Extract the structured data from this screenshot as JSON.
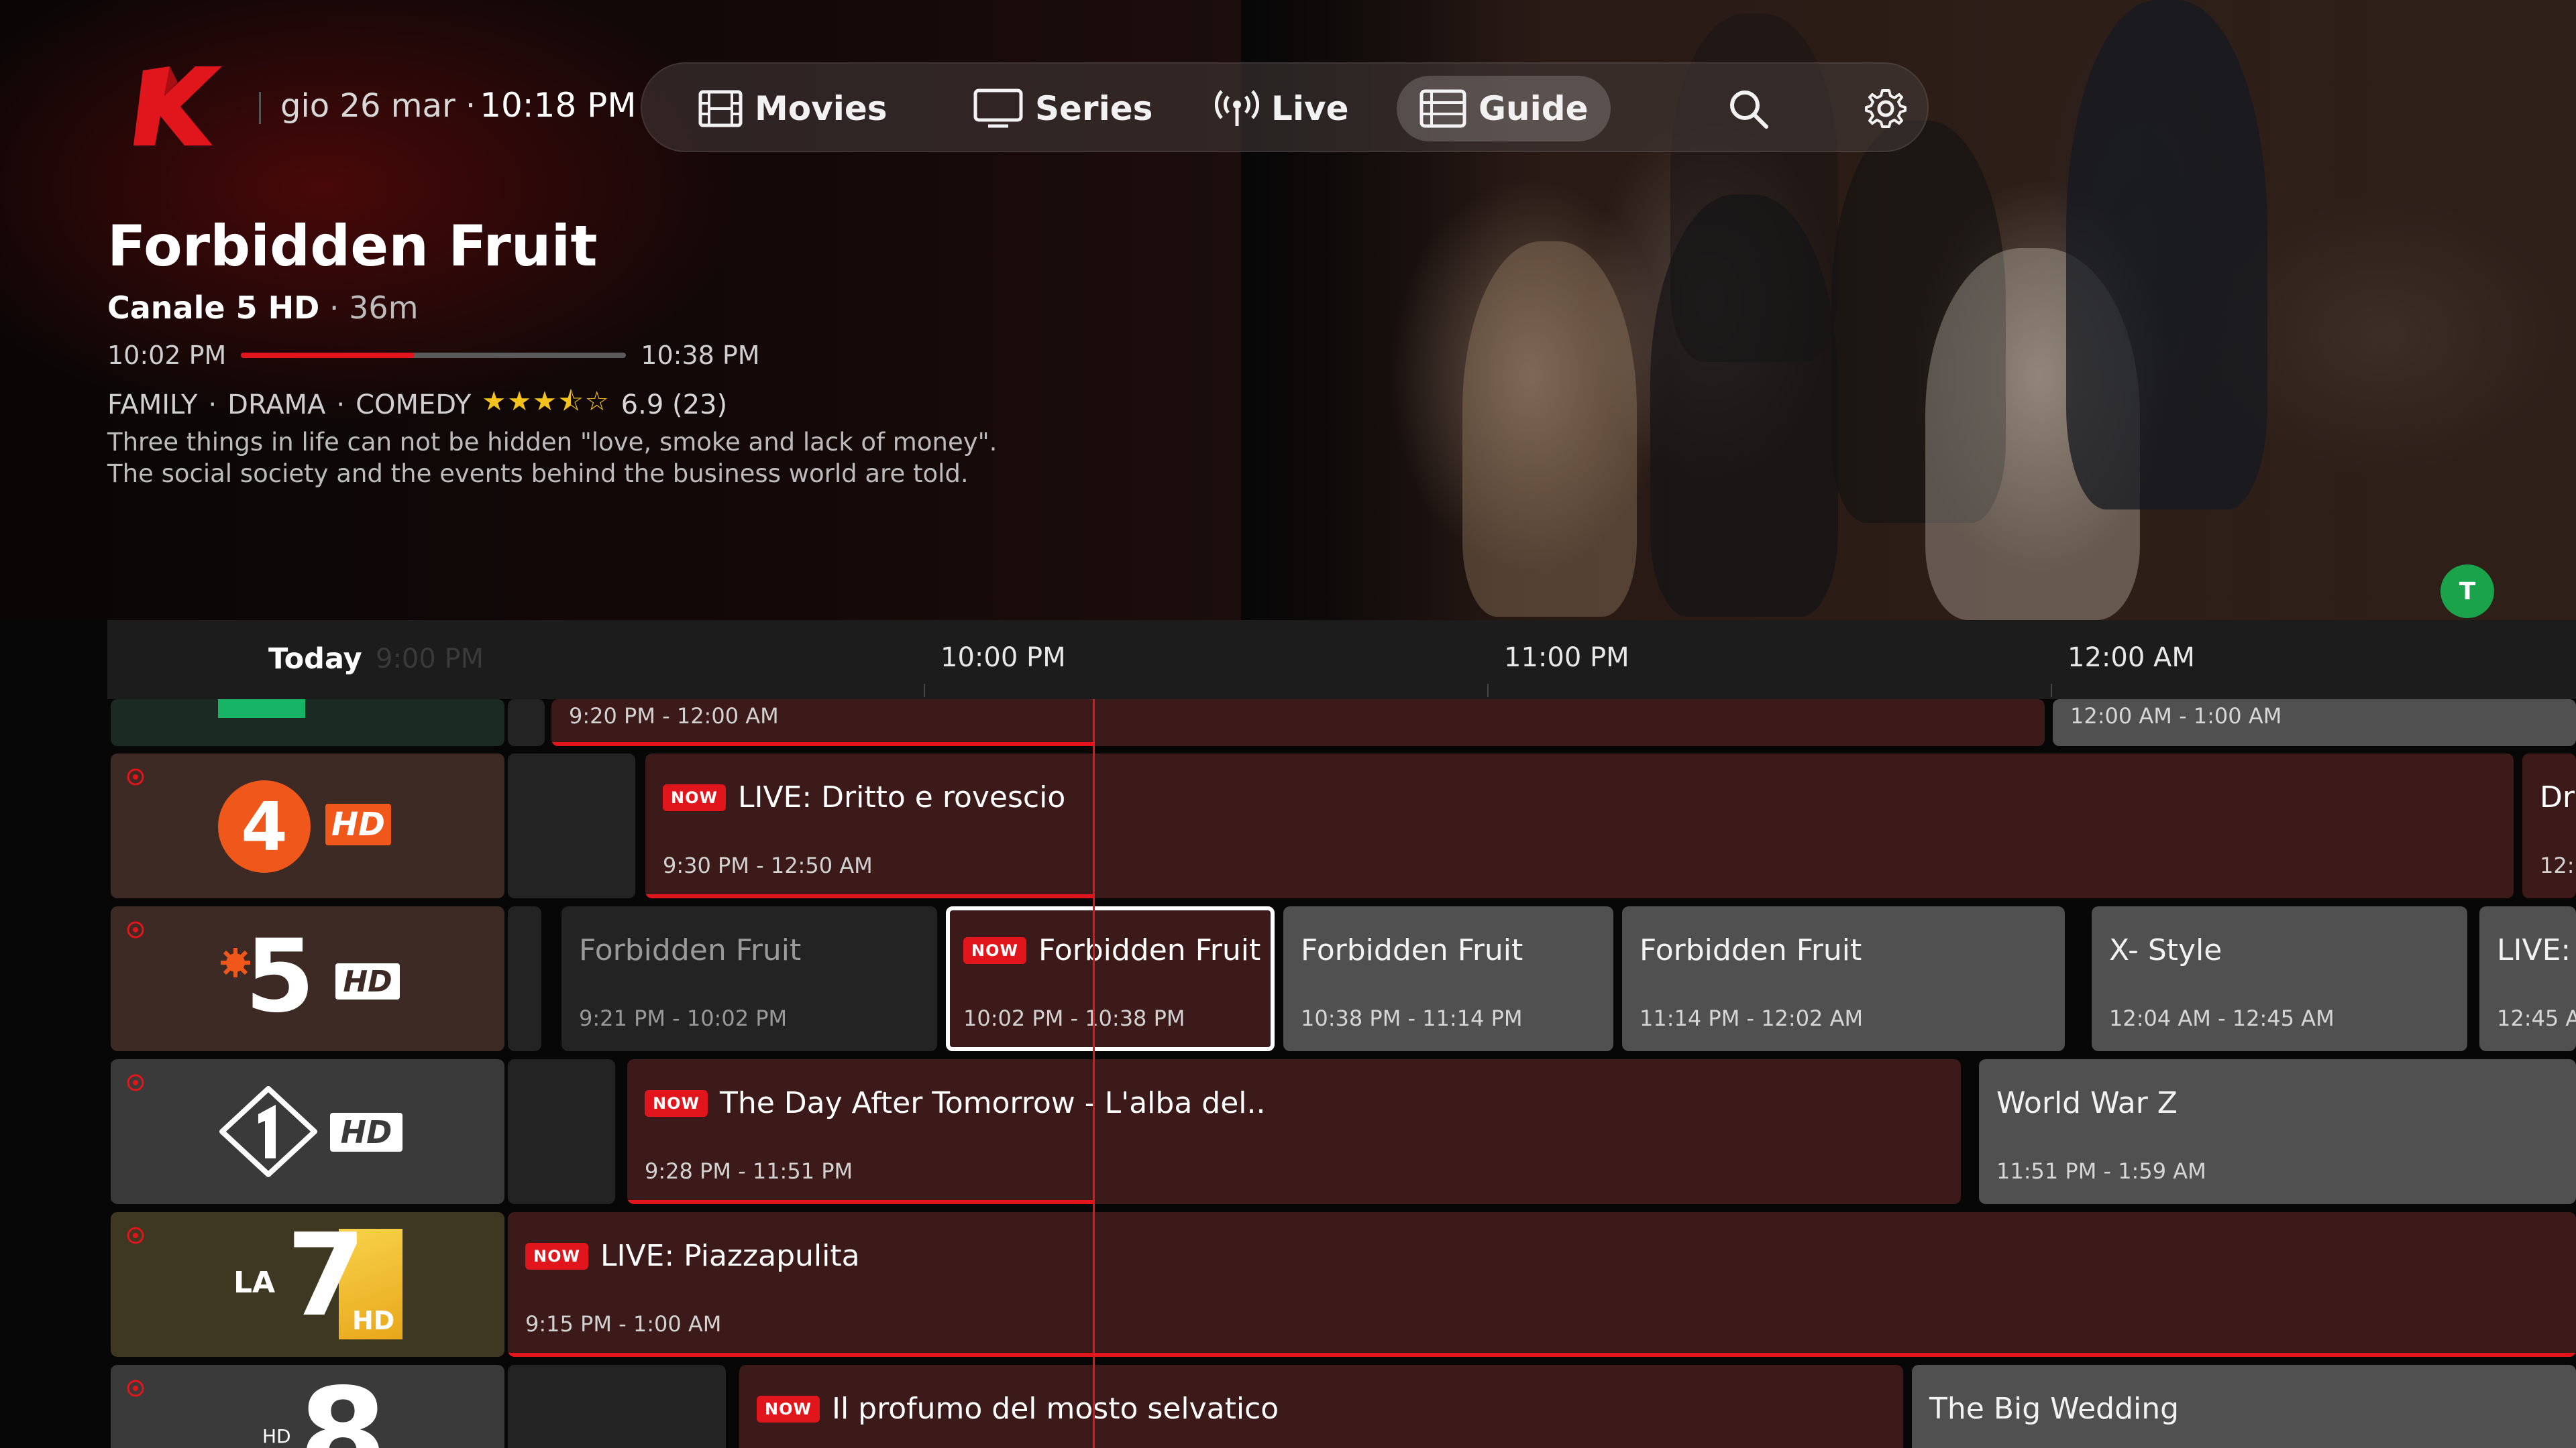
{
  "header": {
    "date": "gio 26 mar ·",
    "time": "10:18 PM"
  },
  "nav": {
    "movies": "Movies",
    "series": "Series",
    "live": "Live",
    "guide": "Guide",
    "active": "Guide"
  },
  "colors": {
    "accent": "#e0161c",
    "avatar": "#1aa34a"
  },
  "featured": {
    "title": "Forbidden Fruit",
    "channel": "Canale 5 HD",
    "duration": "36m",
    "start": "10:02 PM",
    "end": "10:38 PM",
    "progress_percent": 45,
    "genres": [
      "FAMILY",
      "DRAMA",
      "COMEDY"
    ],
    "stars_text": "★★★⯪☆",
    "rating_value": 3.5,
    "rating": "6.9 (23)",
    "description": "Three things in life can not be hidden \"love, smoke and lack of money\". The social society and the events behind the business world are told."
  },
  "avatar_letter": "T",
  "guide": {
    "today": "Today",
    "faded_time": "9:00 PM",
    "times": [
      "10:00 PM",
      "11:00 PM",
      "12:00 AM"
    ],
    "now_label": "NOW",
    "rows": [
      {
        "channel": "partial-green-channel",
        "programs": [
          {
            "time": "9:20 PM - 12:00 AM"
          },
          {
            "time": "12:00 AM - 1:00 AM"
          }
        ]
      },
      {
        "channel": "Rete 4 HD",
        "logo_text": "4",
        "hd": "HD",
        "programs": [
          {
            "title": "LIVE: Dritto e rovescio",
            "time": "9:30 PM - 12:50 AM"
          },
          {
            "title": "Dr",
            "time": "12:"
          }
        ]
      },
      {
        "channel": "Canale 5 HD",
        "logo_text": "5",
        "hd": "HD",
        "programs": [
          {
            "title": "Forbidden Fruit",
            "time": "9:21 PM - 10:02 PM"
          },
          {
            "title": "Forbidden Fruit",
            "time": "10:02 PM - 10:38 PM"
          },
          {
            "title": "Forbidden Fruit",
            "time": "10:38 PM - 11:14 PM"
          },
          {
            "title": "Forbidden Fruit",
            "time": "11:14 PM - 12:02 AM"
          },
          {
            "title": "X- Style",
            "time": "12:04 AM - 12:45 AM"
          },
          {
            "title": "LIVE:",
            "time": "12:45 A"
          }
        ]
      },
      {
        "channel": "Italia 1 HD",
        "hd": "HD",
        "programs": [
          {
            "title": "The Day After Tomorrow - L'alba del..",
            "time": "9:28 PM - 11:51 PM"
          },
          {
            "title": "World War Z",
            "time": "11:51 PM - 1:59 AM"
          }
        ]
      },
      {
        "channel": "La7 HD",
        "logo_text": "LA",
        "logo_text2": "7",
        "hd": "HD",
        "programs": [
          {
            "title": "LIVE: Piazzapulita",
            "time": "9:15 PM - 1:00 AM"
          }
        ]
      },
      {
        "channel": "Canale 8 HD",
        "logo_text": "8",
        "hd": "HD",
        "programs": [
          {
            "title": "Il profumo del mosto selvatico"
          },
          {
            "title": "The Big Wedding"
          }
        ]
      }
    ]
  }
}
